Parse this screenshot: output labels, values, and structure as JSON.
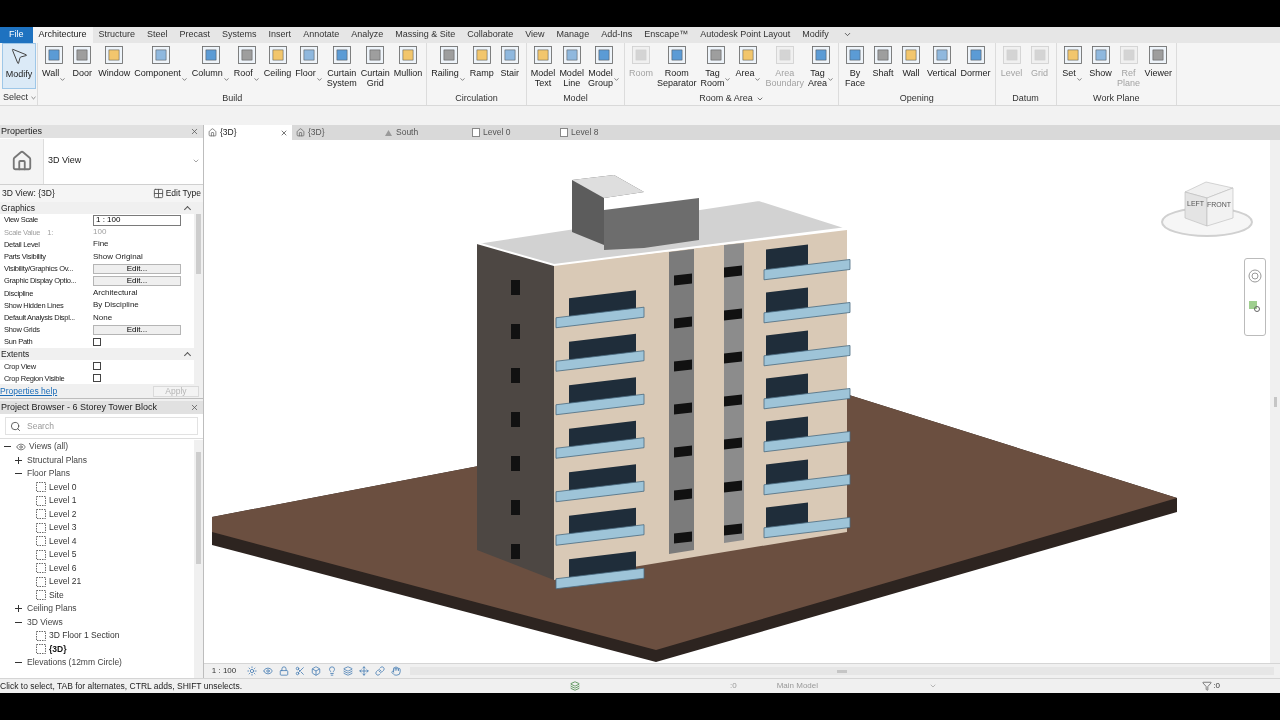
{
  "ribbon_tabs": [
    {
      "label": "File",
      "kind": "file",
      "selected": false
    },
    {
      "label": "Architecture",
      "kind": "tab",
      "selected": true
    },
    {
      "label": "Structure",
      "kind": "tab",
      "selected": false
    },
    {
      "label": "Steel",
      "kind": "tab",
      "selected": false
    },
    {
      "label": "Precast",
      "kind": "tab",
      "selected": false
    },
    {
      "label": "Systems",
      "kind": "tab",
      "selected": false
    },
    {
      "label": "Insert",
      "kind": "tab",
      "selected": false
    },
    {
      "label": "Annotate",
      "kind": "tab",
      "selected": false
    },
    {
      "label": "Analyze",
      "kind": "tab",
      "selected": false
    },
    {
      "label": "Massing & Site",
      "kind": "tab",
      "selected": false
    },
    {
      "label": "Collaborate",
      "kind": "tab",
      "selected": false
    },
    {
      "label": "View",
      "kind": "tab",
      "selected": false
    },
    {
      "label": "Manage",
      "kind": "tab",
      "selected": false
    },
    {
      "label": "Add-Ins",
      "kind": "tab",
      "selected": false
    },
    {
      "label": "Enscape™",
      "kind": "tab",
      "selected": false
    },
    {
      "label": "Autodesk Point Layout",
      "kind": "tab",
      "selected": false
    },
    {
      "label": "Modify",
      "kind": "tab",
      "selected": false
    }
  ],
  "select_panel": {
    "tool": {
      "label": "Modify",
      "selected": true
    },
    "title": "Select",
    "title_dropdown": true
  },
  "ribbon_panels": [
    {
      "title": "Build",
      "title_dropdown": false,
      "tools": [
        {
          "label": "Wall",
          "disabled": false,
          "dropdown": true
        },
        {
          "label": "Door",
          "disabled": false,
          "dropdown": false
        },
        {
          "label": "Window",
          "disabled": false,
          "dropdown": false
        },
        {
          "label": "Component",
          "disabled": false,
          "dropdown": true
        },
        {
          "label": "Column",
          "disabled": false,
          "dropdown": true
        },
        {
          "label": "Roof",
          "disabled": false,
          "dropdown": true
        },
        {
          "label": "Ceiling",
          "disabled": false,
          "dropdown": false
        },
        {
          "label": "Floor",
          "disabled": false,
          "dropdown": true
        },
        {
          "label": "Curtain System",
          "disabled": false,
          "dropdown": false
        },
        {
          "label": "Curtain Grid",
          "disabled": false,
          "dropdown": false
        },
        {
          "label": "Mullion",
          "disabled": false,
          "dropdown": false
        }
      ]
    },
    {
      "title": "Circulation",
      "title_dropdown": false,
      "tools": [
        {
          "label": "Railing",
          "disabled": false,
          "dropdown": true
        },
        {
          "label": "Ramp",
          "disabled": false,
          "dropdown": false
        },
        {
          "label": "Stair",
          "disabled": false,
          "dropdown": false
        }
      ]
    },
    {
      "title": "Model",
      "title_dropdown": false,
      "tools": [
        {
          "label": "Model Text",
          "disabled": false,
          "dropdown": false
        },
        {
          "label": "Model Line",
          "disabled": false,
          "dropdown": false
        },
        {
          "label": "Model Group",
          "disabled": false,
          "dropdown": true
        }
      ]
    },
    {
      "title": "Room & Area",
      "title_dropdown": true,
      "tools": [
        {
          "label": "Room",
          "disabled": true,
          "dropdown": false
        },
        {
          "label": "Room Separator",
          "disabled": false,
          "dropdown": false
        },
        {
          "label": "Tag Room",
          "disabled": false,
          "dropdown": true
        },
        {
          "label": "Area",
          "disabled": false,
          "dropdown": true
        },
        {
          "label": "Area Boundary",
          "disabled": true,
          "dropdown": false
        },
        {
          "label": "Tag Area",
          "disabled": false,
          "dropdown": true
        }
      ]
    },
    {
      "title": "Opening",
      "title_dropdown": false,
      "tools": [
        {
          "label": "By Face",
          "disabled": false,
          "dropdown": false
        },
        {
          "label": "Shaft",
          "disabled": false,
          "dropdown": false
        },
        {
          "label": "Wall",
          "disabled": false,
          "dropdown": false
        },
        {
          "label": "Vertical",
          "disabled": false,
          "dropdown": false
        },
        {
          "label": "Dormer",
          "disabled": false,
          "dropdown": false
        }
      ]
    },
    {
      "title": "Datum",
      "title_dropdown": false,
      "tools": [
        {
          "label": "Level",
          "disabled": true,
          "dropdown": false
        },
        {
          "label": "Grid",
          "disabled": true,
          "dropdown": false
        }
      ]
    },
    {
      "title": "Work Plane",
      "title_dropdown": false,
      "tools": [
        {
          "label": "Set",
          "disabled": false,
          "dropdown": true
        },
        {
          "label": "Show",
          "disabled": false,
          "dropdown": false
        },
        {
          "label": "Ref Plane",
          "disabled": true,
          "dropdown": false
        },
        {
          "label": "Viewer",
          "disabled": false,
          "dropdown": false
        }
      ]
    }
  ],
  "properties": {
    "title": "Properties",
    "type_name": "3D View",
    "instance": "3D View: {3D}",
    "edit_type": "Edit Type",
    "sections": [
      {
        "title": "Graphics",
        "expanded": true,
        "rows": [
          {
            "label": "View Scale",
            "kind": "field",
            "value": "1 : 100",
            "disabled": false
          },
          {
            "label": "Scale Value    1:",
            "kind": "text",
            "value": "100",
            "disabled": true
          },
          {
            "label": "Detail Level",
            "kind": "text",
            "value": "Fine",
            "disabled": false
          },
          {
            "label": "Parts Visibility",
            "kind": "text",
            "value": "Show Original",
            "disabled": false
          },
          {
            "label": "Visibility/Graphics Ov...",
            "kind": "button",
            "value": "Edit...",
            "disabled": false
          },
          {
            "label": "Graphic Display Optio...",
            "kind": "button",
            "value": "Edit...",
            "disabled": false
          },
          {
            "label": "Discipline",
            "kind": "text",
            "value": "Architectural",
            "disabled": false
          },
          {
            "label": "Show Hidden Lines",
            "kind": "text",
            "value": "By Discipline",
            "disabled": false
          },
          {
            "label": "Default Analysis Displ...",
            "kind": "text",
            "value": "None",
            "disabled": false
          },
          {
            "label": "Show Grids",
            "kind": "button",
            "value": "Edit...",
            "disabled": false
          },
          {
            "label": "Sun Path",
            "kind": "checkbox",
            "checked": false,
            "disabled": false
          }
        ]
      },
      {
        "title": "Extents",
        "expanded": true,
        "rows": [
          {
            "label": "Crop View",
            "kind": "checkbox",
            "checked": false,
            "disabled": false
          },
          {
            "label": "Crop Region Visible",
            "kind": "checkbox",
            "checked": false,
            "disabled": false
          }
        ]
      }
    ],
    "help_link": "Properties help",
    "apply": {
      "label": "Apply",
      "disabled": true
    }
  },
  "project_browser": {
    "title": "Project Browser - 6 Storey Tower Block",
    "search": {
      "placeholder": "Search"
    },
    "tree": [
      {
        "label": "Views (all)",
        "kind": "root",
        "expanded": true,
        "children": [
          {
            "label": "Structural Plans",
            "kind": "folder",
            "expanded": false
          },
          {
            "label": "Floor Plans",
            "kind": "folder",
            "expanded": true,
            "children": [
              {
                "label": "Level 0",
                "kind": "view",
                "current": false
              },
              {
                "label": "Level 1",
                "kind": "view",
                "current": false
              },
              {
                "label": "Level 2",
                "kind": "view",
                "current": false
              },
              {
                "label": "Level 3",
                "kind": "view",
                "current": false
              },
              {
                "label": "Level 4",
                "kind": "view",
                "current": false
              },
              {
                "label": "Level 5",
                "kind": "view",
                "current": false
              },
              {
                "label": "Level 6",
                "kind": "view",
                "current": false
              },
              {
                "label": "Level 21",
                "kind": "view",
                "current": false
              },
              {
                "label": "Site",
                "kind": "view",
                "current": false
              }
            ]
          },
          {
            "label": "Ceiling Plans",
            "kind": "folder",
            "expanded": false
          },
          {
            "label": "3D Views",
            "kind": "folder",
            "expanded": true,
            "children": [
              {
                "label": "3D Floor 1 Section",
                "kind": "view",
                "current": false
              },
              {
                "label": "{3D}",
                "kind": "view",
                "current": true
              }
            ]
          },
          {
            "label": "Elevations (12mm Circle)",
            "kind": "folder",
            "expanded": true
          }
        ]
      }
    ]
  },
  "view_tabs": [
    {
      "label": "{3D}",
      "kind": "model",
      "selected": true
    },
    {
      "label": "{3D}",
      "kind": "model",
      "selected": false
    },
    {
      "label": "South",
      "kind": "elevation",
      "selected": false
    },
    {
      "label": "Level 0",
      "kind": "plan",
      "selected": false
    },
    {
      "label": "Level 8",
      "kind": "plan",
      "selected": false
    }
  ],
  "view_cube": {
    "left": "LEFT",
    "front": "FRONT"
  },
  "view_control_bar": {
    "scale": "1 : 100"
  },
  "status_bar": {
    "message": "Click to select, TAB for alternates, CTRL adds, SHIFT unselects.",
    "worksets": ":0",
    "model": "Main Model",
    "filter_count": ":0"
  }
}
